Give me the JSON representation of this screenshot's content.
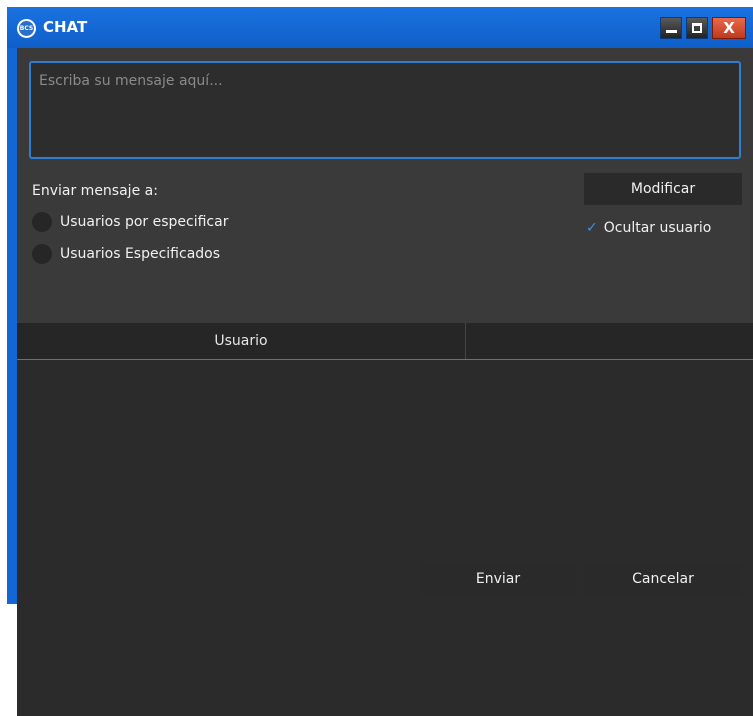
{
  "window": {
    "title": "CHAT",
    "app_icon_text": "BCS",
    "close_glyph": "X"
  },
  "message": {
    "placeholder": "Escriba su mensaje aquí..."
  },
  "send_to": {
    "label": "Enviar mensaje a:",
    "options": [
      {
        "label": "Usuarios por especificar",
        "selected": false
      },
      {
        "label": "Usuarios Especificados",
        "selected": false
      }
    ]
  },
  "actions": {
    "modify_label": "Modificar",
    "hide_user_label": "Ocultar usuario",
    "hide_user_checked": true,
    "check_glyph": "✓"
  },
  "table": {
    "columns": [
      "Usuario",
      ""
    ],
    "rows": []
  },
  "footer": {
    "send_label": "Enviar",
    "cancel_label": "Cancelar"
  },
  "colors": {
    "titlebar": "#1367d4",
    "accent": "#2e7fd4",
    "panel": "#3a3a3a",
    "button": "#2a2a2a"
  }
}
